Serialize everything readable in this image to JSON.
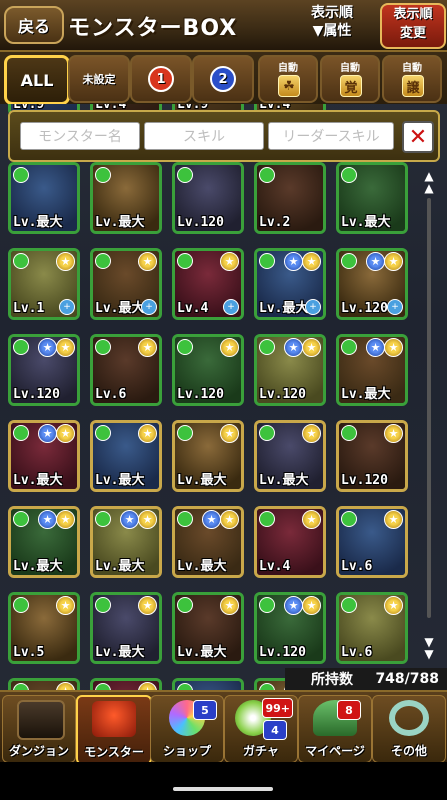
{
  "header": {
    "back_label": "戻る",
    "title": "モンスターBOX",
    "sort_label": "表示順",
    "sort_value": "▼属性",
    "sort_change_line1": "表示順",
    "sort_change_line2": "変更"
  },
  "filters": {
    "all": "ALL",
    "unset": "未設定",
    "group1": "1",
    "group2": "2",
    "auto1_label": "自動",
    "auto1_icon": "☘",
    "auto2_label": "自動",
    "auto2_icon": "覚",
    "auto3_label": "自動",
    "auto3_icon": "譲"
  },
  "search": {
    "monster_name_placeholder": "モンスター名",
    "skill_placeholder": "スキル",
    "leader_skill_placeholder": "リーダースキル",
    "close_icon": "✕"
  },
  "partial_top_row": [
    "Lv.9",
    "Lv.4",
    "Lv.9",
    "Lv.4"
  ],
  "monsters": [
    {
      "lv": "Lv.最大",
      "stars": [],
      "plus": false
    },
    {
      "lv": "Lv.最大",
      "stars": [],
      "plus": false
    },
    {
      "lv": "Lv.120",
      "stars": [],
      "plus": false
    },
    {
      "lv": "Lv.2",
      "stars": [],
      "plus": false
    },
    {
      "lv": "Lv.最大",
      "stars": [],
      "plus": false
    },
    {
      "lv": "Lv.1",
      "stars": [
        "gold"
      ],
      "plus": true
    },
    {
      "lv": "Lv.最大",
      "stars": [
        "gold"
      ],
      "plus": true
    },
    {
      "lv": "Lv.4",
      "stars": [
        "gold"
      ],
      "plus": true
    },
    {
      "lv": "Lv.最大",
      "stars": [
        "blue",
        "gold"
      ],
      "plus": true
    },
    {
      "lv": "Lv.120",
      "stars": [
        "blue",
        "gold"
      ],
      "plus": true
    },
    {
      "lv": "Lv.120",
      "stars": [
        "blue",
        "gold"
      ],
      "plus": false
    },
    {
      "lv": "Lv.6",
      "stars": [
        "gold"
      ],
      "plus": false
    },
    {
      "lv": "Lv.120",
      "stars": [
        "gold"
      ],
      "plus": false
    },
    {
      "lv": "Lv.120",
      "stars": [
        "blue",
        "gold"
      ],
      "plus": false
    },
    {
      "lv": "Lv.最大",
      "stars": [
        "blue",
        "gold"
      ],
      "plus": false
    },
    {
      "lv": "Lv.最大",
      "stars": [
        "blue",
        "gold"
      ],
      "plus": false
    },
    {
      "lv": "Lv.最大",
      "stars": [
        "gold"
      ],
      "plus": false
    },
    {
      "lv": "Lv.最大",
      "stars": [
        "gold"
      ],
      "plus": false
    },
    {
      "lv": "Lv.最大",
      "stars": [
        "gold"
      ],
      "plus": false
    },
    {
      "lv": "Lv.120",
      "stars": [
        "gold"
      ],
      "plus": false
    },
    {
      "lv": "Lv.最大",
      "stars": [
        "blue",
        "gold"
      ],
      "plus": false
    },
    {
      "lv": "Lv.最大",
      "stars": [
        "blue",
        "gold"
      ],
      "plus": false
    },
    {
      "lv": "Lv.最大",
      "stars": [
        "blue",
        "gold"
      ],
      "plus": false
    },
    {
      "lv": "Lv.4",
      "stars": [
        "gold"
      ],
      "plus": false
    },
    {
      "lv": "Lv.6",
      "stars": [
        "gold"
      ],
      "plus": false
    },
    {
      "lv": "Lv.5",
      "stars": [
        "gold"
      ],
      "plus": false
    },
    {
      "lv": "Lv.最大",
      "stars": [
        "gold"
      ],
      "plus": false
    },
    {
      "lv": "Lv.最大",
      "stars": [
        "gold"
      ],
      "plus": false
    },
    {
      "lv": "Lv.120",
      "stars": [
        "blue",
        "gold"
      ],
      "plus": false
    },
    {
      "lv": "Lv.6",
      "stars": [
        "gold"
      ],
      "plus": false
    },
    {
      "lv": "",
      "stars": [
        "gold"
      ],
      "plus": false
    },
    {
      "lv": "",
      "stars": [
        "gold"
      ],
      "plus": false
    },
    {
      "lv": "",
      "stars": [],
      "plus": false
    },
    {
      "lv": "",
      "stars": [
        "blue",
        "gold"
      ],
      "plus": false
    },
    {
      "lv": "",
      "stars": [
        "blue",
        "gold"
      ],
      "plus": false
    }
  ],
  "owned": {
    "label": "所持数",
    "value": "748/788"
  },
  "nav": {
    "dungeon": "ダンジョン",
    "monster": "モンスター",
    "shop": "ショップ",
    "shop_badge": "5",
    "gacha": "ガチャ",
    "gacha_badge_top": "99+",
    "gacha_badge_bottom": "4",
    "mypage": "マイページ",
    "mypage_badge": "8",
    "other": "その他"
  },
  "colors": {
    "wood_dark": "#2b1c08",
    "gold_border": "#ffd24a",
    "wood_attr_green": "#3aa03a"
  }
}
